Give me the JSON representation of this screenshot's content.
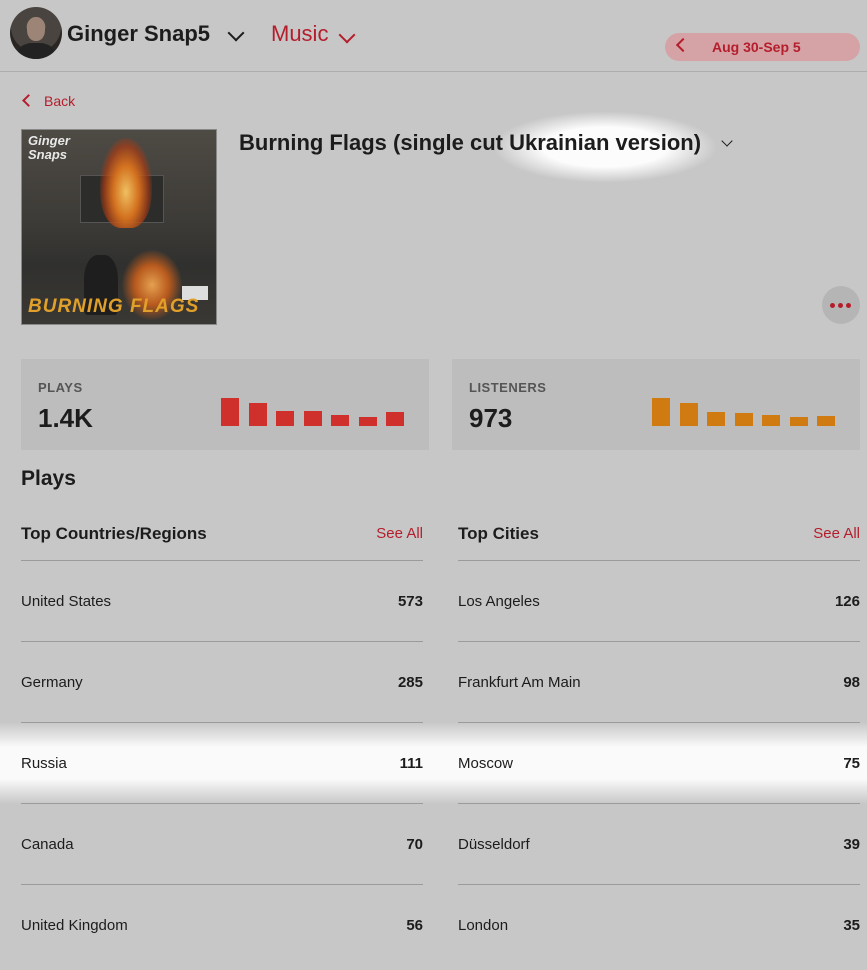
{
  "header": {
    "account_name": "Ginger Snap5",
    "section_menu": "Music",
    "date_range": "Aug 30-Sep 5"
  },
  "nav": {
    "back_label": "Back"
  },
  "track": {
    "title": "Burning Flags (single cut Ukrainian version)",
    "cover_art_text_logo": "Ginger Snaps",
    "cover_art_text_title": "BURNING FLAGS"
  },
  "stats": {
    "plays": {
      "label": "PLAYS",
      "value": "1.4K",
      "color": "#d0302c",
      "trend_relative": [
        1.0,
        0.82,
        0.55,
        0.52,
        0.4,
        0.32,
        0.5
      ]
    },
    "listeners": {
      "label": "LISTENERS",
      "value": "973",
      "color": "#d07a12",
      "trend_relative": [
        1.0,
        0.82,
        0.5,
        0.48,
        0.4,
        0.32,
        0.34
      ]
    }
  },
  "section": {
    "title": "Plays"
  },
  "countries": {
    "title": "Top Countries/Regions",
    "see_all": "See All",
    "rows": [
      {
        "name": "United States",
        "value": "573"
      },
      {
        "name": "Germany",
        "value": "285"
      },
      {
        "name": "Russia",
        "value": "111"
      },
      {
        "name": "Canada",
        "value": "70"
      },
      {
        "name": "United Kingdom",
        "value": "56"
      }
    ]
  },
  "cities": {
    "title": "Top Cities",
    "see_all": "See All",
    "rows": [
      {
        "name": "Los Angeles",
        "value": "126"
      },
      {
        "name": "Frankfurt Am Main",
        "value": "98"
      },
      {
        "name": "Moscow",
        "value": "75"
      },
      {
        "name": "Düsseldorf",
        "value": "39"
      },
      {
        "name": "London",
        "value": "35"
      }
    ]
  },
  "colors": {
    "accent": "#b41e2c",
    "background": "#c7c7c7"
  }
}
